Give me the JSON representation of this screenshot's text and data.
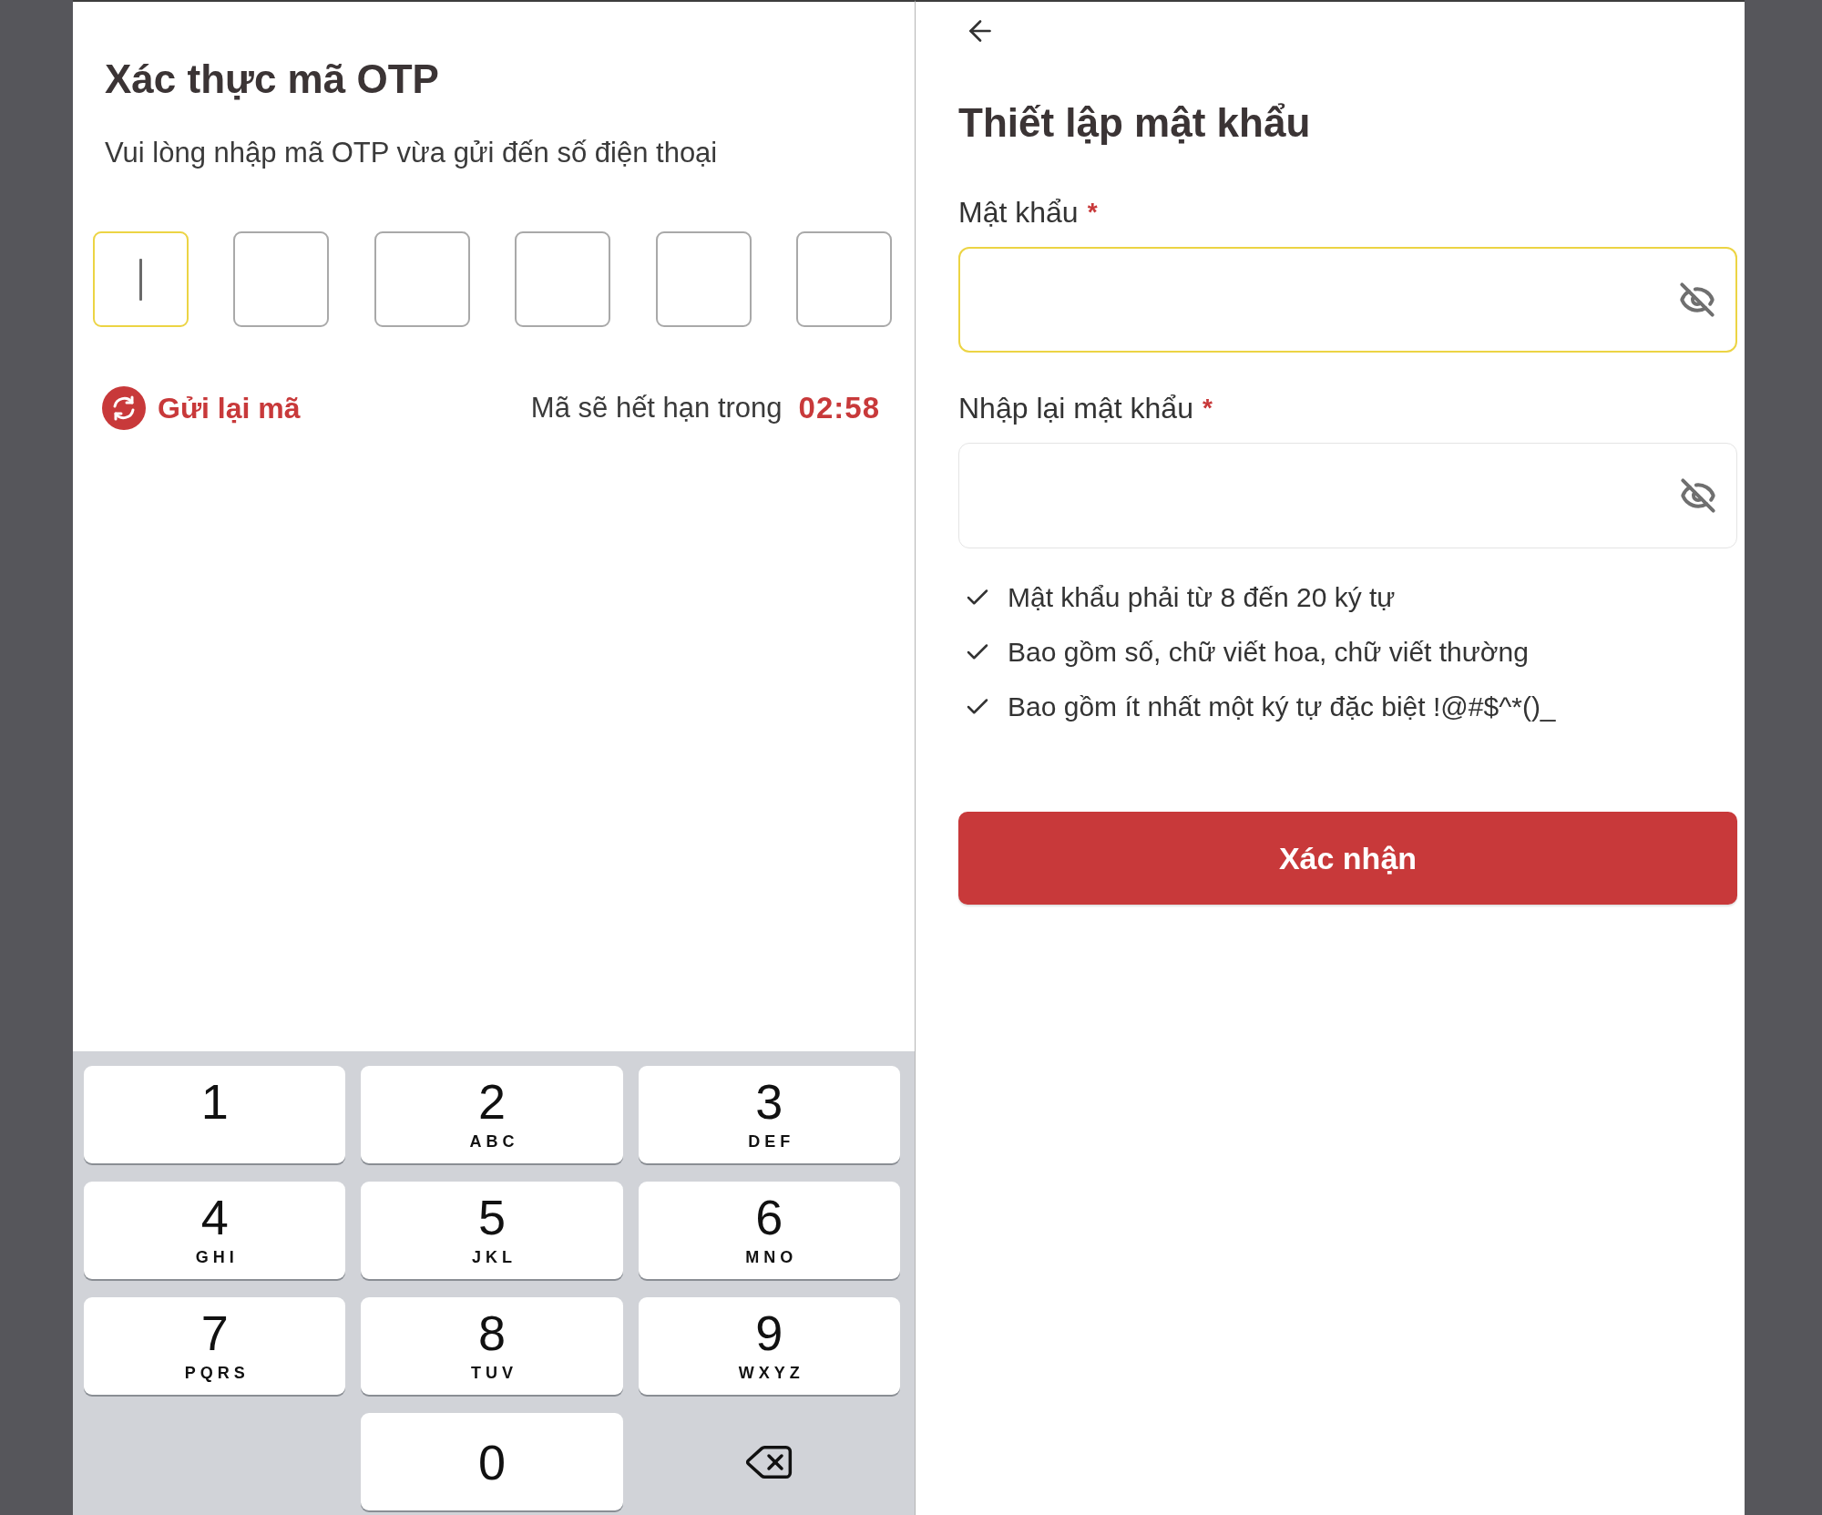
{
  "otp_screen": {
    "title": "Xác thực mã OTP",
    "subtitle": "Vui lòng nhập mã OTP vừa gửi đến số điện thoại",
    "otp_boxes": [
      {
        "focused": true
      },
      {
        "focused": false
      },
      {
        "focused": false
      },
      {
        "focused": false
      },
      {
        "focused": false
      },
      {
        "focused": false
      }
    ],
    "resend": {
      "label": "Gửi lại mã"
    },
    "expiry": {
      "label": "Mã sẽ hết hạn trong",
      "countdown": "02:58"
    }
  },
  "keypad": {
    "keys": [
      {
        "kind": "digit",
        "digit": "1"
      },
      {
        "kind": "digit",
        "digit": "2",
        "letters": "ABC"
      },
      {
        "kind": "digit",
        "digit": "3",
        "letters": "DEF"
      },
      {
        "kind": "digit",
        "digit": "4",
        "letters": "GHI"
      },
      {
        "kind": "digit",
        "digit": "5",
        "letters": "JKL"
      },
      {
        "kind": "digit",
        "digit": "6",
        "letters": "MNO"
      },
      {
        "kind": "digit",
        "digit": "7",
        "letters": "PQRS"
      },
      {
        "kind": "digit",
        "digit": "8",
        "letters": "TUV"
      },
      {
        "kind": "digit",
        "digit": "9",
        "letters": "WXYZ"
      },
      {
        "kind": "digit",
        "digit": "0"
      },
      {
        "kind": "delete"
      }
    ]
  },
  "password_screen": {
    "title": "Thiết lập mật khẩu",
    "fields": [
      {
        "label": "Mật khẩu",
        "required_mark": "*",
        "focused": true
      },
      {
        "label": "Nhập lại mật khẩu",
        "required_mark": "*",
        "focused": false
      }
    ],
    "rules": [
      "Mật khẩu phải từ 8 đến 20 ký tự",
      "Bao gồm số, chữ viết hoa, chữ viết thường",
      "Bao gồm ít nhất một ký tự đặc biệt !@#$^*()_"
    ],
    "submit_button": "Xác nhận"
  }
}
